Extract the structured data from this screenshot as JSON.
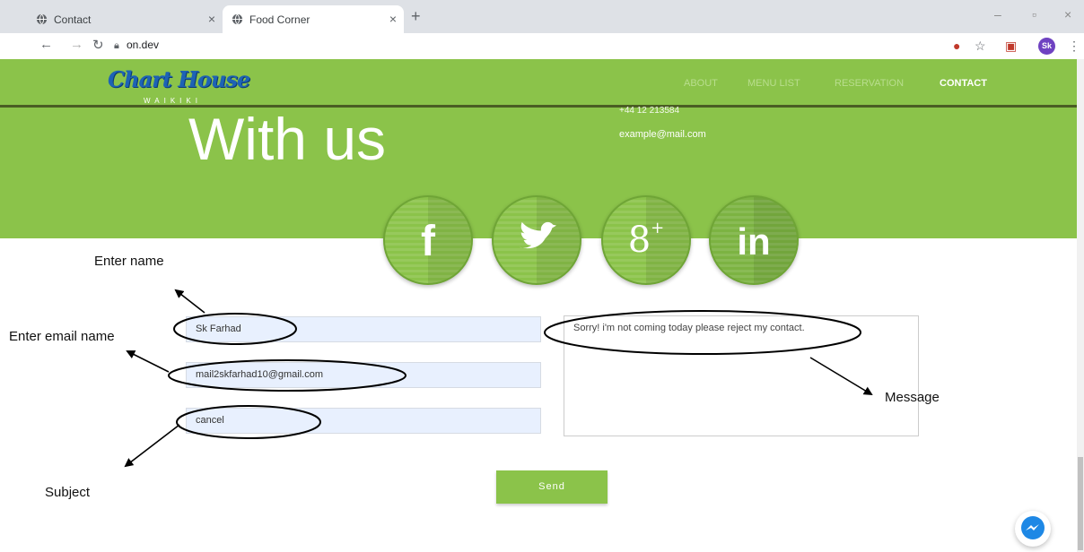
{
  "browser": {
    "tabs": [
      {
        "title": "Contact",
        "active": false
      },
      {
        "title": "Food Corner",
        "active": true
      }
    ],
    "url": "on.dev",
    "avatar_initials": "Sk"
  },
  "site": {
    "logo": "Chart House",
    "logo_sub": "WAIKIKI",
    "nav": [
      "ABOUT",
      "MENU LIST",
      "RESERVATION",
      "CONTACT"
    ],
    "nav_active": "CONTACT",
    "hero_heading": "With us",
    "phone": "+44 12 213584",
    "email": "example@mail.com",
    "social": [
      "facebook",
      "twitter",
      "google-plus",
      "linkedin"
    ]
  },
  "form": {
    "name_value": "Sk Farhad",
    "email_value": "mail2skfarhad10@gmail.com",
    "subject_value": "cancel",
    "message_value": "Sorry! i'm not coming today please reject my contact.",
    "send_label": "Send"
  },
  "annotations": {
    "name": "Enter name",
    "email": "Enter email name",
    "subject": "Subject",
    "message": "Message"
  },
  "colors": {
    "brand_green": "#8bc34a",
    "nav_dark": "#4a5d23",
    "input_fill": "#e8f0fe",
    "logo_blue": "#1e63b5"
  }
}
